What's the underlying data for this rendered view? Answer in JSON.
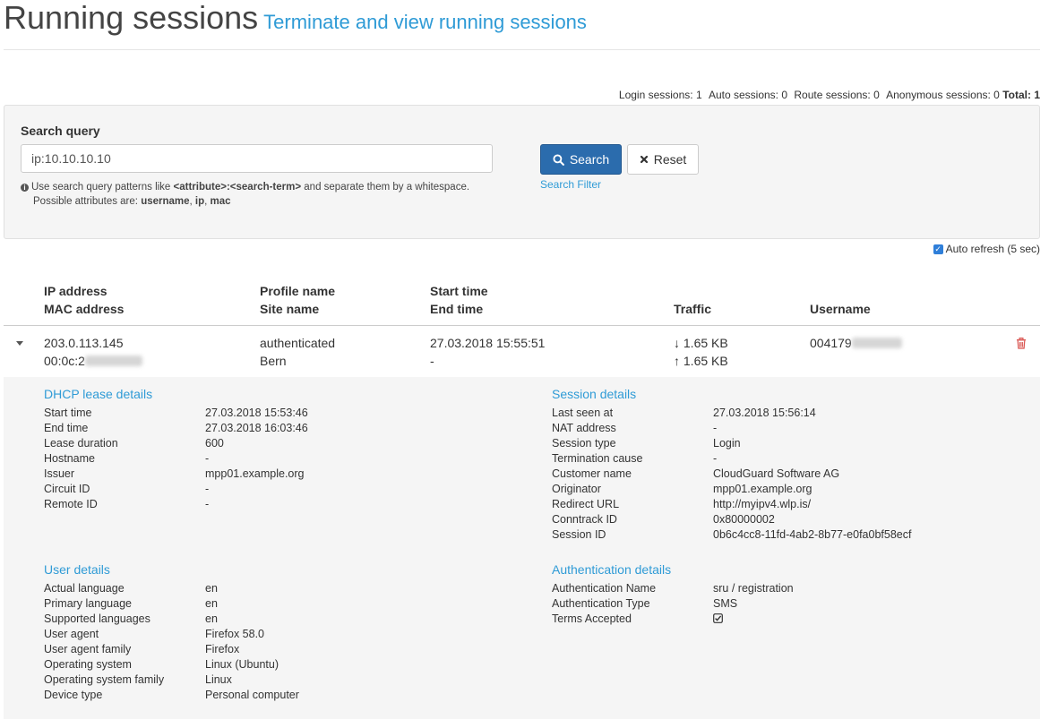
{
  "header": {
    "title": "Running sessions",
    "subtitle": "Terminate and view running sessions"
  },
  "counts": {
    "login": "Login sessions: 1",
    "auto": "Auto sessions: 0",
    "route": "Route sessions: 0",
    "anonymous": "Anonymous sessions: 0",
    "total_label": "Total:",
    "total_value": "1"
  },
  "search": {
    "label": "Search query",
    "value": "ip:10.10.10.10",
    "help_prefix": "Use search query patterns like",
    "help_pattern": "<attribute>:<search-term>",
    "help_suffix": "and separate them by a whitespace.",
    "help_line2_prefix": "Possible attributes are:",
    "attr_username": "username",
    "attr_ip": "ip",
    "attr_mac": "mac",
    "search_button": "Search",
    "reset_button": "Reset",
    "filter_link": "Search Filter"
  },
  "auto_refresh": {
    "label": "Auto refresh (5 sec)",
    "checked": true
  },
  "table": {
    "headers": {
      "ip": "IP address",
      "mac": "MAC address",
      "profile": "Profile name",
      "site": "Site name",
      "start": "Start time",
      "end": "End time",
      "traffic": "Traffic",
      "username": "Username"
    },
    "rows": [
      {
        "ip": "203.0.113.145",
        "mac_visible": "00:0c:2",
        "profile": "authenticated",
        "site": "Bern",
        "start": "27.03.2018 15:55:51",
        "end": "-",
        "traffic_down": "1.65 KB",
        "traffic_up": "1.65 KB",
        "username_visible": "004179"
      }
    ]
  },
  "details": {
    "dhcp": {
      "title": "DHCP lease details",
      "items": [
        {
          "label": "Start time",
          "value": "27.03.2018 15:53:46"
        },
        {
          "label": "End time",
          "value": "27.03.2018 16:03:46"
        },
        {
          "label": "Lease duration",
          "value": "600"
        },
        {
          "label": "Hostname",
          "value": "-"
        },
        {
          "label": "Issuer",
          "value": "mpp01.example.org"
        },
        {
          "label": "Circuit ID",
          "value": "-"
        },
        {
          "label": "Remote ID",
          "value": "-"
        }
      ]
    },
    "session": {
      "title": "Session details",
      "items": [
        {
          "label": "Last seen at",
          "value": "27.03.2018 15:56:14"
        },
        {
          "label": "NAT address",
          "value": "-"
        },
        {
          "label": "Session type",
          "value": "Login"
        },
        {
          "label": "Termination cause",
          "value": "-"
        },
        {
          "label": "Customer name",
          "value": "CloudGuard Software AG"
        },
        {
          "label": "Originator",
          "value": "mpp01.example.org"
        },
        {
          "label": "Redirect URL",
          "value": "http://myipv4.wlp.is/"
        },
        {
          "label": "Conntrack ID",
          "value": "0x80000002"
        },
        {
          "label": "Session ID",
          "value": "0b6c4cc8-11fd-4ab2-8b77-e0fa0bf58ecf"
        }
      ]
    },
    "user": {
      "title": "User details",
      "items": [
        {
          "label": "Actual language",
          "value": "en"
        },
        {
          "label": "Primary language",
          "value": "en"
        },
        {
          "label": "Supported languages",
          "value": "en"
        },
        {
          "label": "User agent",
          "value": "Firefox 58.0"
        },
        {
          "label": "User agent family",
          "value": "Firefox"
        },
        {
          "label": "Operating system",
          "value": "Linux (Ubuntu)"
        },
        {
          "label": "Operating system family",
          "value": "Linux"
        },
        {
          "label": "Device type",
          "value": "Personal computer"
        }
      ]
    },
    "auth": {
      "title": "Authentication details",
      "items": [
        {
          "label": "Authentication Name",
          "value": "sru / registration"
        },
        {
          "label": "Authentication Type",
          "value": "SMS"
        },
        {
          "label": "Terms Accepted",
          "value": "",
          "icon": "check-square-icon"
        }
      ]
    }
  },
  "colors": {
    "accent": "#2f9bd6",
    "primary_button": "#2b6cad",
    "delete": "#d9534f"
  }
}
